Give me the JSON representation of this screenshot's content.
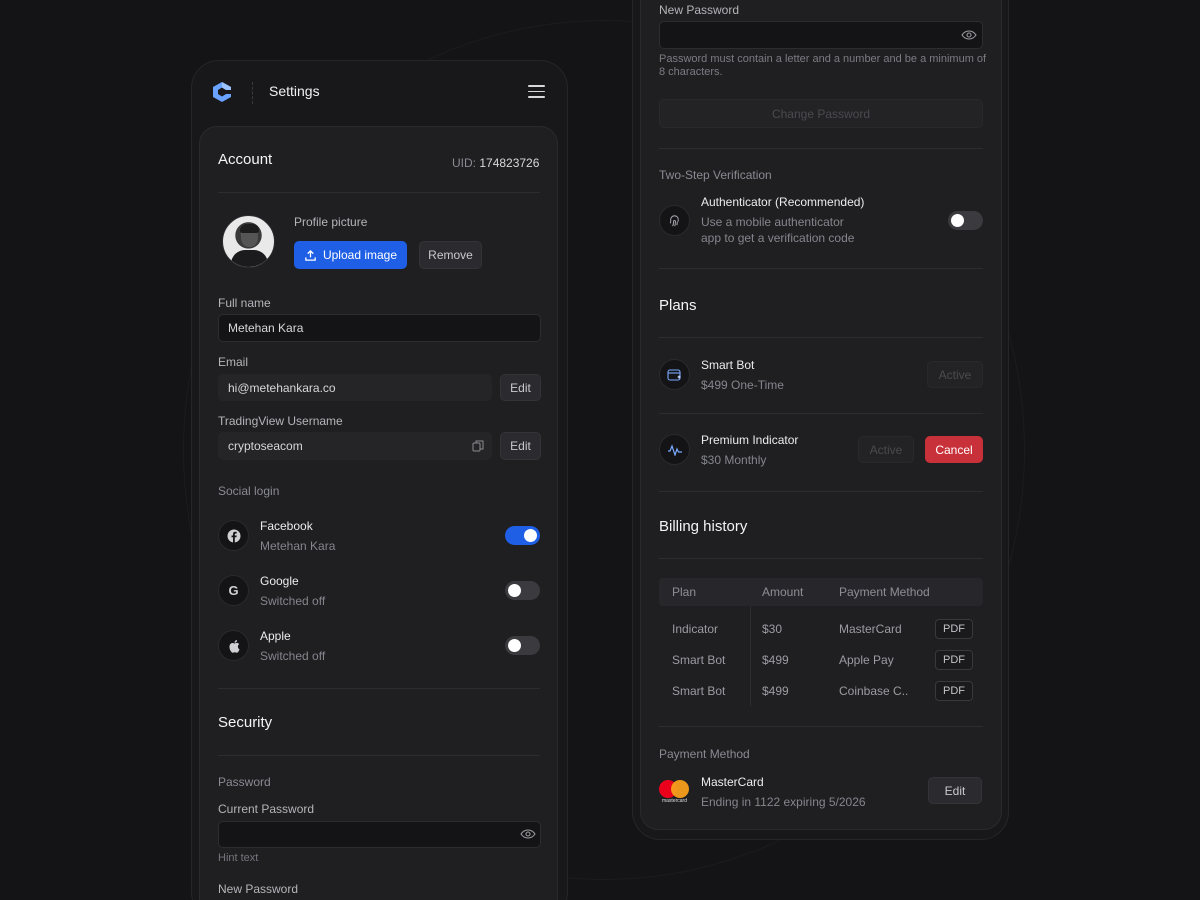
{
  "header": {
    "title": "Settings"
  },
  "account": {
    "title": "Account",
    "uid_label": "UID:",
    "uid_value": "174823726",
    "profile_picture_label": "Profile picture",
    "upload_label": "Upload image",
    "remove_label": "Remove",
    "full_name_label": "Full name",
    "full_name_value": "Metehan Kara",
    "email_label": "Email",
    "email_value": "hi@metehankara.co",
    "email_edit": "Edit",
    "tv_label": "TradingView Username",
    "tv_value": "cryptoseacom",
    "tv_edit": "Edit"
  },
  "social": {
    "title": "Social login",
    "items": [
      {
        "name": "Facebook",
        "sub": "Metehan Kara",
        "icon": "facebook-icon",
        "enabled": true
      },
      {
        "name": "Google",
        "sub": "Switched off",
        "icon": "google-icon",
        "enabled": false
      },
      {
        "name": "Apple",
        "sub": "Switched off",
        "icon": "apple-icon",
        "enabled": false
      }
    ]
  },
  "security": {
    "title": "Security",
    "password_section": "Password",
    "current_password_label": "Current Password",
    "current_hint": "Hint text",
    "new_password_label": "New Password",
    "new_password_hint": "Password must contain a letter and a number and be a minimum of 8 characters.",
    "change_password": "Change Password",
    "two_step_title": "Two-Step Verification",
    "authenticator_title": "Authenticator (Recommended)",
    "authenticator_desc_1": "Use a mobile authenticator",
    "authenticator_desc_2": "app to get a verification code",
    "authenticator_enabled": false
  },
  "plans": {
    "title": "Plans",
    "items": [
      {
        "name": "Smart Bot",
        "price": "$499 One-Time",
        "status": "Active"
      },
      {
        "name": "Premium Indicator",
        "price": "$30 Monthly",
        "status": "Active",
        "cancel": "Cancel"
      }
    ]
  },
  "billing": {
    "title": "Billing history",
    "columns": [
      "Plan",
      "Amount",
      "Payment Method"
    ],
    "rows": [
      {
        "plan": "Indicator",
        "amount": "$30",
        "method": "MasterCard",
        "action": "PDF"
      },
      {
        "plan": "Smart Bot",
        "amount": "$499",
        "method": "Apple Pay",
        "action": "PDF"
      },
      {
        "plan": "Smart Bot",
        "amount": "$499",
        "method": "Coinbase C..",
        "action": "PDF"
      }
    ]
  },
  "payment": {
    "title": "Payment Method",
    "card_name": "MasterCard",
    "card_desc": "Ending in 1122 expiring 5/2026",
    "edit": "Edit",
    "card_logo_text": "mastercard"
  },
  "colors": {
    "accent": "#1e5fe6",
    "danger": "#c8303a",
    "background": "#141416",
    "card": "#1f1f22"
  }
}
